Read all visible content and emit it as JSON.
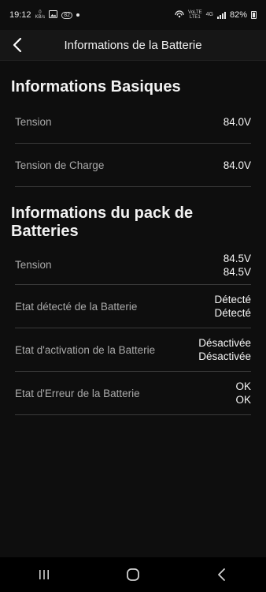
{
  "status_bar": {
    "time": "19:12",
    "kbs_value": "0",
    "kbs_unit": "KB/s",
    "badge": "82",
    "network_label_top": "VoLTE",
    "network_label_bottom": "LTE1",
    "network_type": "4G",
    "battery_percent": "82%"
  },
  "header": {
    "title": "Informations de la Batterie",
    "back_icon": "chevron-left-icon"
  },
  "sections": [
    {
      "title": "Informations Basiques",
      "rows": [
        {
          "label": "Tension",
          "value1": "84.0V"
        },
        {
          "label": "Tension de Charge",
          "value1": "84.0V"
        }
      ]
    },
    {
      "title": "Informations du pack de Batteries",
      "rows": [
        {
          "label": "Tension",
          "value1": "84.5V",
          "value2": "84.5V"
        },
        {
          "label": "Etat détecté de la Batterie",
          "value1": "Détecté",
          "value2": "Détecté"
        },
        {
          "label": "Etat d'activation de la Batterie",
          "value1": "Désactivée",
          "value2": "Désactivée"
        },
        {
          "label": "Etat d'Erreur de la Batterie",
          "value1": "OK",
          "value2": "OK"
        }
      ]
    }
  ],
  "nav_bar": {
    "recents_icon": "recents-icon",
    "home_icon": "home-icon",
    "back_icon": "back-icon"
  },
  "colors": {
    "background": "#0e0e0e",
    "header_bg": "#161616",
    "text_primary": "#ffffff",
    "text_label": "#a9a9a9",
    "divider": "#3a3a3a"
  }
}
